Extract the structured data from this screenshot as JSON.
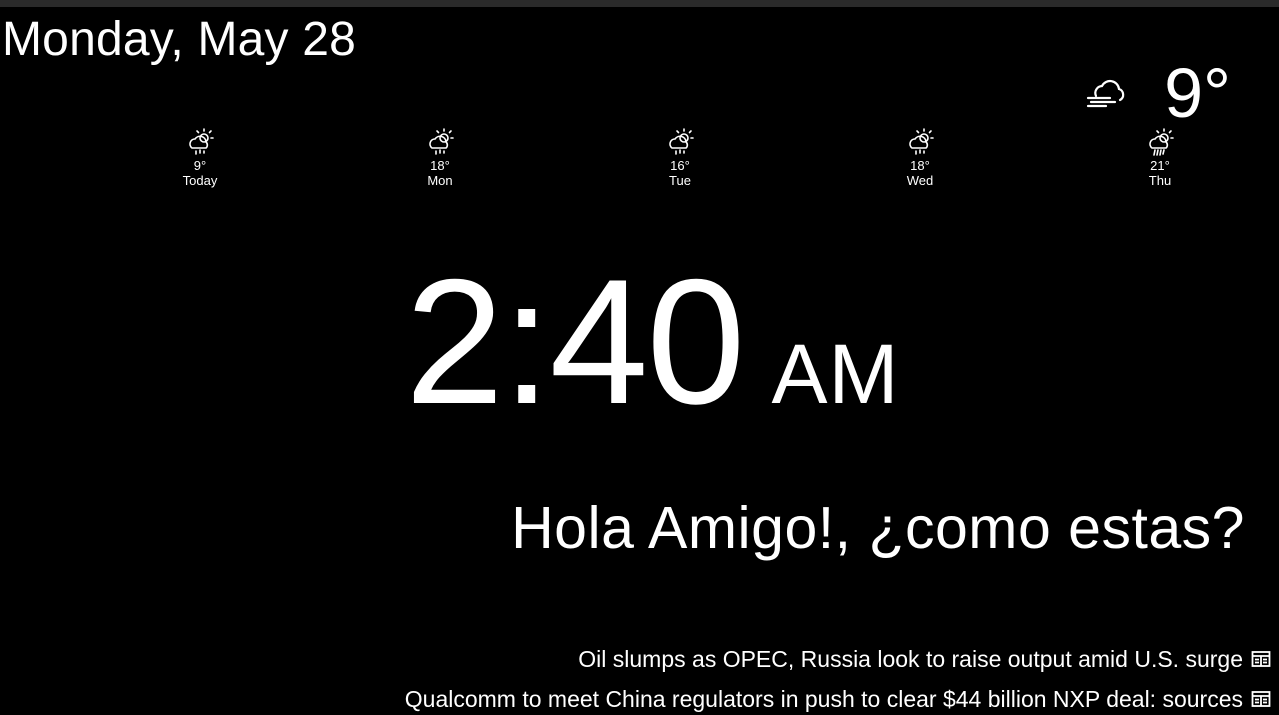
{
  "date": "Monday, May 28",
  "current_weather": {
    "icon": "cloud-wind-icon",
    "temperature": "9°"
  },
  "forecast": [
    {
      "icon": "cloud-sun-rain-icon",
      "temp": "9°",
      "day": "Today"
    },
    {
      "icon": "cloud-sun-rain-icon",
      "temp": "18°",
      "day": "Mon"
    },
    {
      "icon": "cloud-sun-rain-icon",
      "temp": "16°",
      "day": "Tue"
    },
    {
      "icon": "cloud-sun-rain-icon",
      "temp": "18°",
      "day": "Wed"
    },
    {
      "icon": "cloud-sun-heavy-rain-icon",
      "temp": "21°",
      "day": "Thu"
    }
  ],
  "clock": {
    "time": "2:40",
    "ampm": "AM"
  },
  "greeting": "Hola Amigo!, ¿como estas?",
  "news": [
    {
      "headline": "Oil slumps as OPEC, Russia look to raise output amid U.S. surge",
      "icon": "newspaper-icon"
    },
    {
      "headline": "Qualcomm to meet China regulators in push to clear $44 billion NXP deal: sources",
      "icon": "newspaper-icon"
    }
  ],
  "colors": {
    "background": "#000000",
    "text": "#ffffff"
  }
}
